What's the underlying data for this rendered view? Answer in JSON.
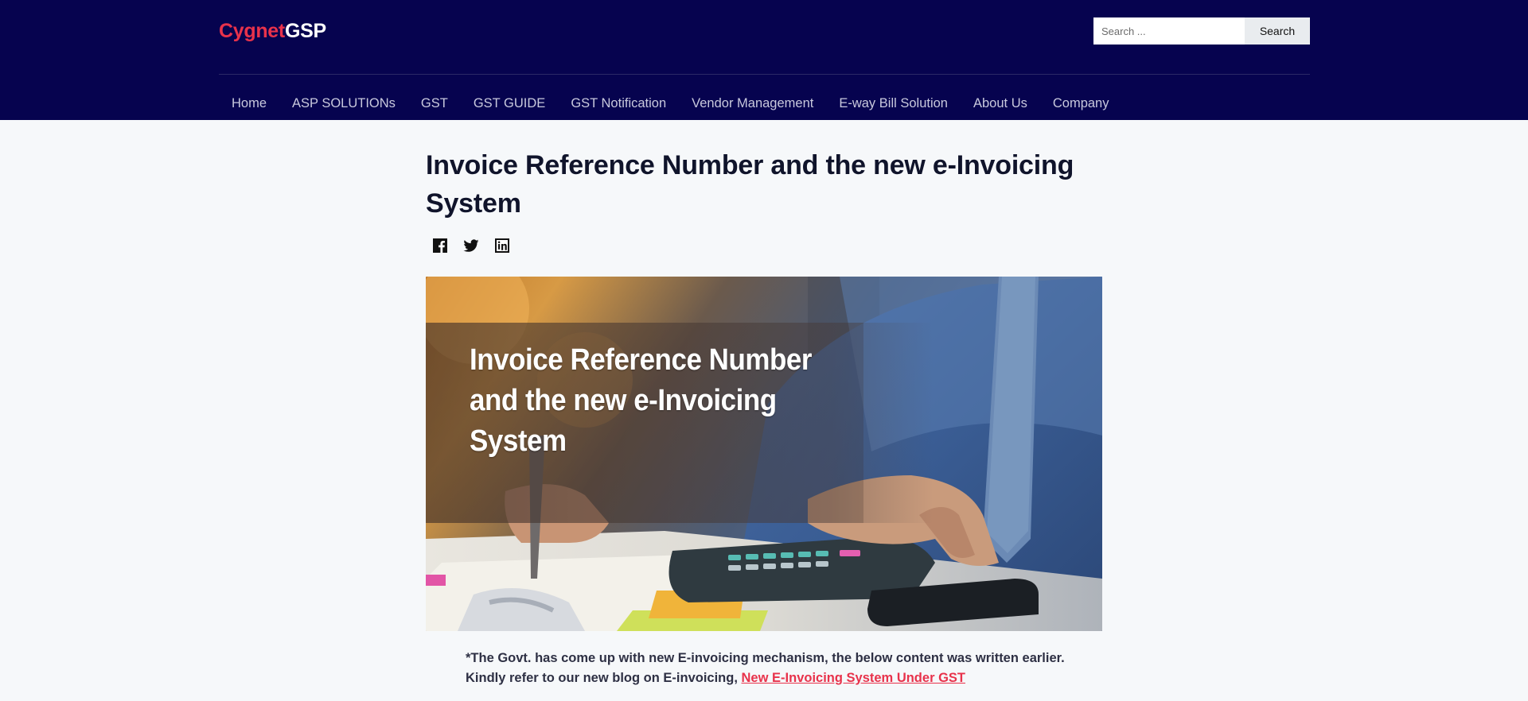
{
  "header": {
    "brand_part1": "Cygnet",
    "brand_part2": "GSP",
    "search_placeholder": "Search ...",
    "search_button": "Search"
  },
  "nav": {
    "items": [
      "Home",
      "ASP SOLUTIONs",
      "GST",
      "GST GUIDE",
      "GST Notification",
      "Vendor Management",
      "E-way Bill Solution",
      "About Us",
      "Company"
    ]
  },
  "article": {
    "title": "Invoice Reference Number and the new e-Invoicing System",
    "social": [
      "facebook-icon",
      "twitter-icon",
      "linkedin-icon"
    ],
    "hero_caption_lines": [
      "Invoice Reference Number",
      "and the new e-Invoicing",
      "System"
    ],
    "note_text": "*The Govt. has come up with new E-invoicing mechanism, the below content was written earlier. Kindly refer to our new blog on E-invoicing, ",
    "note_link": "New E-Invoicing System Under GST"
  },
  "colors": {
    "header_bg": "#06034f",
    "brand_accent": "#e8324b",
    "page_bg": "#f6f8fa",
    "title": "#10142b"
  }
}
